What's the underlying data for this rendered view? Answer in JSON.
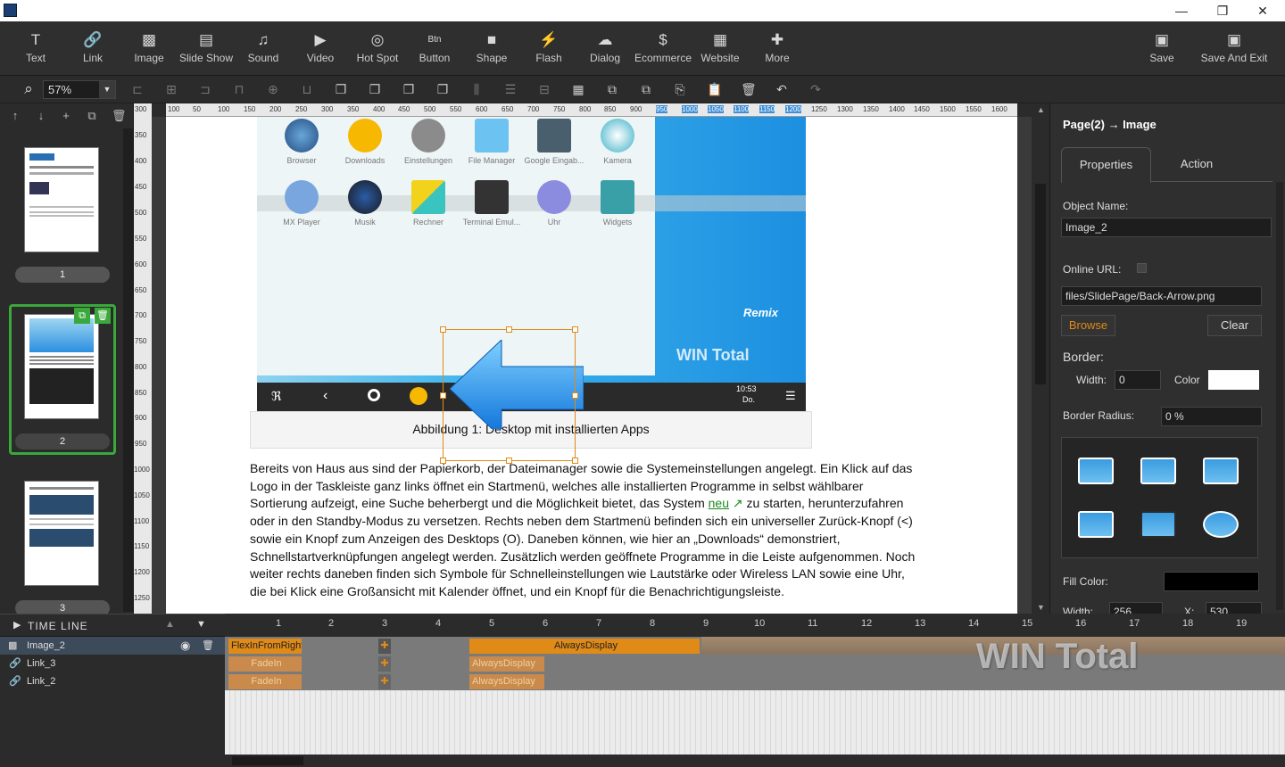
{
  "window": {
    "minimize": "—",
    "restore": "❐",
    "close": "✕"
  },
  "toolbar": {
    "items": [
      {
        "label": "Text",
        "icon": "text-icon",
        "glyph": "T"
      },
      {
        "label": "Link",
        "icon": "link-icon",
        "glyph": "🔗"
      },
      {
        "label": "Image",
        "icon": "image-icon",
        "glyph": "▩"
      },
      {
        "label": "Slide Show",
        "icon": "slideshow-icon",
        "glyph": "▤"
      },
      {
        "label": "Sound",
        "icon": "sound-icon",
        "glyph": "♫"
      },
      {
        "label": "Video",
        "icon": "video-icon",
        "glyph": "▶"
      },
      {
        "label": "Hot Spot",
        "icon": "hotspot-icon",
        "glyph": "◎"
      },
      {
        "label": "Button",
        "icon": "button-icon",
        "glyph": "Btn"
      },
      {
        "label": "Shape",
        "icon": "shape-icon",
        "glyph": "■"
      },
      {
        "label": "Flash",
        "icon": "flash-icon",
        "glyph": "⚡"
      },
      {
        "label": "Dialog",
        "icon": "dialog-icon",
        "glyph": "☁"
      },
      {
        "label": "Ecommerce",
        "icon": "dollar-icon",
        "glyph": "$"
      },
      {
        "label": "Website",
        "icon": "website-icon",
        "glyph": "▦"
      },
      {
        "label": "More",
        "icon": "puzzle-icon",
        "glyph": "✚"
      }
    ],
    "save": "Save",
    "save_exit": "Save And Exit"
  },
  "zoom": {
    "value": "57%"
  },
  "pages": {
    "labels": [
      "1",
      "2",
      "3"
    ]
  },
  "ruler": {
    "h": [
      "100",
      "50",
      "100",
      "150",
      "200",
      "250",
      "300",
      "350",
      "400",
      "450",
      "500",
      "550",
      "600",
      "650",
      "700",
      "750",
      "800",
      "850",
      "900",
      "950",
      "1000",
      "1050",
      "1100",
      "1150",
      "1200",
      "1250",
      "1300",
      "1350",
      "1400",
      "1450",
      "1500",
      "1550",
      "1600",
      "1650"
    ],
    "v": [
      "300",
      "350",
      "400",
      "450",
      "500",
      "550",
      "600",
      "650",
      "700",
      "750",
      "800",
      "850",
      "900",
      "950",
      "1000",
      "1050",
      "1100",
      "1150",
      "1200",
      "1250"
    ]
  },
  "canvas": {
    "apps_row1": [
      "Browser",
      "Downloads",
      "Einstellungen",
      "File Manager",
      "Google Eingab...",
      "Kamera"
    ],
    "apps_row2": [
      "MX Player",
      "Musik",
      "Rechner",
      "Terminal Emul...",
      "Uhr",
      "Widgets"
    ],
    "logo_remix": "Remix",
    "logo_wintotal": "WIN Total",
    "clock_time": "10:53",
    "clock_day": "Do.",
    "caption": "Abbildung 1: Desktop mit installierten Apps",
    "body_lines": [
      "Bereits von Haus aus sind der Papierkorb, der Dateimanager sowie die Systemeinstellungen angelegt. Ein Klick auf das",
      "Logo in der Taskleiste ganz links öffnet ein Startmenü, welches alle installierten Programme in selbst wählbarer",
      "oder in den Standby-Modus zu versetzen. Rechts neben dem Startmenü befinden sich ein universeller Zurück-Knopf (<)",
      "sowie ein Knopf zum Anzeigen des Desktops (O). Daneben können, wie hier an „Downloads“ demonstriert,",
      "Schnellstartverknüpfungen angelegt werden. Zusätzlich werden geöffnete Programme in die Leiste aufgenommen. Noch",
      "weiter rechts daneben finden sich Symbole für Schnelleinstellungen wie Lautstärke oder Wireless LAN sowie eine Uhr,",
      "die bei Klick eine Großansicht mit Kalender öffnet, und ein Knopf für die Benachrichtigungsleiste."
    ],
    "line3_before": "Sortierung aufzeigt, eine Suche beherbergt und die Möglichkeit bietet, das System ",
    "line3_link": "neu",
    "line3_after": " zu starten, herunterzufahren"
  },
  "props": {
    "title": "Page(2) → Image",
    "tab_properties": "Properties",
    "tab_action": "Action",
    "object_name_label": "Object Name:",
    "object_name": "Image_2",
    "online_url_label": "Online URL:",
    "url": "files/SlidePage/Back-Arrow.png",
    "browse": "Browse",
    "clear": "Clear",
    "border_label": "Border:",
    "width_label": "Width:",
    "width_value": "0",
    "color_label": "Color",
    "radius_label": "Border Radius:",
    "radius_value": "0 %",
    "fill_label": "Fill Color:",
    "bottom_label": "Width:",
    "bottom_value": "256",
    "bottom_x_label": "X:",
    "bottom_x_value": "530",
    "colors": {
      "border_color": "#ffffff",
      "fill_color": "#000000",
      "accent": "#e08a18"
    }
  },
  "timeline": {
    "title": "TIME LINE",
    "rows": [
      {
        "name": "Image_2",
        "icon": "image-icon"
      },
      {
        "name": "Link_3",
        "icon": "link-icon"
      },
      {
        "name": "Link_2",
        "icon": "link-icon"
      }
    ],
    "numbers": [
      "1",
      "2",
      "3",
      "4",
      "5",
      "6",
      "7",
      "8",
      "9",
      "10",
      "11",
      "12",
      "13",
      "14",
      "15",
      "16",
      "17",
      "18",
      "19"
    ],
    "anim": {
      "flexin": "FlexInFromRight",
      "always": "AlwaysDisplay",
      "fadein": "FadeIn",
      "always2": "AlwaysDisplay",
      "fadein2": "FadeIn",
      "always3": "AlwaysDisplay"
    },
    "watermark": "WIN Total"
  }
}
